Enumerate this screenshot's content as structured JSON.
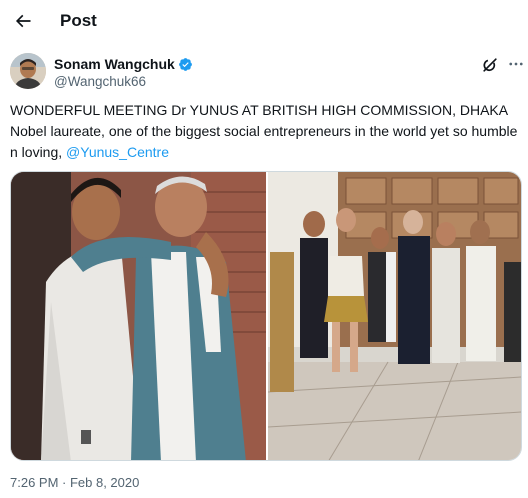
{
  "header": {
    "title": "Post",
    "back_icon": "arrow-left-icon"
  },
  "author": {
    "display_name": "Sonam Wangchuk",
    "handle": "@Wangchuk66",
    "verified": true,
    "verified_color": "#1d9bf0"
  },
  "tweet": {
    "line1": "WONDERFUL MEETING Dr YUNUS AT BRITISH HIGH COMMISSION, DHAKA",
    "line2": "Nobel laureate, one of the biggest social entrepreneurs in the world yet so humble n loving, ",
    "mention": "@Yunus_Centre",
    "mention_color": "#1d9bf0"
  },
  "media": {
    "count": 2,
    "photos": [
      {
        "subject": "two men embracing, one in white shawl"
      },
      {
        "subject": "group of nine people standing in a hall"
      }
    ]
  },
  "meta": {
    "timestamp": "7:26 PM · Feb 8, 2020"
  },
  "colors": {
    "text": "#0f1419",
    "secondary": "#536471",
    "border": "#cfd9de"
  }
}
